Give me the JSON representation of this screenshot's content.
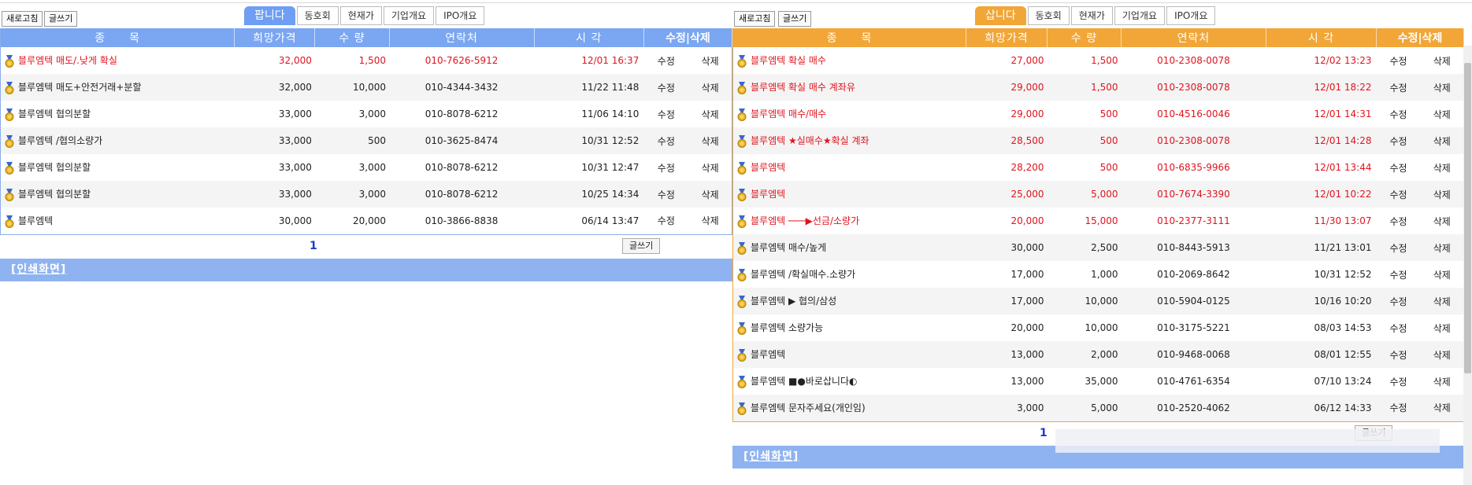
{
  "sell": {
    "refresh_label": "새로고침",
    "write_label": "글쓰기",
    "tabs": [
      "팝니다",
      "동호회",
      "현재가",
      "기업개요",
      "IPO개요"
    ],
    "headers": [
      "종　　목",
      "희망가격",
      "수 량",
      "연락처",
      "시 각",
      "수정|삭제"
    ],
    "rows": [
      {
        "title": "블루엠텍 매도/.낮게 확실",
        "price": "32,000",
        "qty": "1,500",
        "contact": "010-7626-5912",
        "time": "12/01 16:37",
        "red": true
      },
      {
        "title": "블루엠텍 매도+안전거래+분할",
        "price": "32,000",
        "qty": "10,000",
        "contact": "010-4344-3432",
        "time": "11/22 11:48",
        "red": false
      },
      {
        "title": "블루엠텍 협의분할",
        "price": "33,000",
        "qty": "3,000",
        "contact": "010-8078-6212",
        "time": "11/06 14:10",
        "red": false
      },
      {
        "title": "블루엠텍 /협의소량가",
        "price": "33,000",
        "qty": "500",
        "contact": "010-3625-8474",
        "time": "10/31 12:52",
        "red": false
      },
      {
        "title": "블루엠텍 협의분할",
        "price": "33,000",
        "qty": "3,000",
        "contact": "010-8078-6212",
        "time": "10/31 12:47",
        "red": false
      },
      {
        "title": "블루엠텍 협의분할",
        "price": "33,000",
        "qty": "3,000",
        "contact": "010-8078-6212",
        "time": "10/25 14:34",
        "red": false
      },
      {
        "title": "블루엠텍",
        "price": "30,000",
        "qty": "20,000",
        "contact": "010-3866-8838",
        "time": "06/14 13:47",
        "red": false
      }
    ],
    "edit_label": "수정",
    "delete_label": "삭제",
    "page": "1",
    "write_bottom_label": "글쓰기",
    "print_label": "[인쇄화면]"
  },
  "buy": {
    "refresh_label": "새로고침",
    "write_label": "글쓰기",
    "tabs": [
      "삽니다",
      "동호회",
      "현재가",
      "기업개요",
      "IPO개요"
    ],
    "headers": [
      "종　　목",
      "희망가격",
      "수 량",
      "연락처",
      "시 각",
      "수정|삭제"
    ],
    "rows": [
      {
        "title": "블루엠텍 확실 매수",
        "price": "27,000",
        "qty": "1,500",
        "contact": "010-2308-0078",
        "time": "12/02 13:23",
        "red": true
      },
      {
        "title": "블루엠텍 확실 매수 계좌유",
        "price": "29,000",
        "qty": "1,500",
        "contact": "010-2308-0078",
        "time": "12/01 18:22",
        "red": true
      },
      {
        "title": "블루엠텍 매수/매수",
        "price": "29,000",
        "qty": "500",
        "contact": "010-4516-0046",
        "time": "12/01 14:31",
        "red": true
      },
      {
        "title": "블루엠텍 ★실매수★확실 계좌",
        "price": "28,500",
        "qty": "500",
        "contact": "010-2308-0078",
        "time": "12/01 14:28",
        "red": true
      },
      {
        "title": "블루엠텍",
        "price": "28,200",
        "qty": "500",
        "contact": "010-6835-9966",
        "time": "12/01 13:44",
        "red": true
      },
      {
        "title": "블루엠텍",
        "price": "25,000",
        "qty": "5,000",
        "contact": "010-7674-3390",
        "time": "12/01 10:22",
        "red": true
      },
      {
        "title": "블루엠텍 ───▶선금/소량가",
        "price": "20,000",
        "qty": "15,000",
        "contact": "010-2377-3111",
        "time": "11/30 13:07",
        "red": true
      },
      {
        "title": "블루엠텍 매수/높게",
        "price": "30,000",
        "qty": "2,500",
        "contact": "010-8443-5913",
        "time": "11/21 13:01",
        "red": false
      },
      {
        "title": "블루엠텍 /확실매수.소량가",
        "price": "17,000",
        "qty": "1,000",
        "contact": "010-2069-8642",
        "time": "10/31 12:52",
        "red": false
      },
      {
        "title": "블루엠텍 ▶ 협의/삼성",
        "price": "17,000",
        "qty": "10,000",
        "contact": "010-5904-0125",
        "time": "10/16 10:20",
        "red": false
      },
      {
        "title": "블루엠텍 소량가능",
        "price": "20,000",
        "qty": "10,000",
        "contact": "010-3175-5221",
        "time": "08/03 14:53",
        "red": false
      },
      {
        "title": "블루엠텍",
        "price": "13,000",
        "qty": "2,000",
        "contact": "010-9468-0068",
        "time": "08/01 12:55",
        "red": false
      },
      {
        "title": "블루엠텍 ■●바로삽니다◐",
        "price": "13,000",
        "qty": "35,000",
        "contact": "010-4761-6354",
        "time": "07/10 13:24",
        "red": false
      },
      {
        "title": "블루엠텍 문자주세요(개인임)",
        "price": "3,000",
        "qty": "5,000",
        "contact": "010-2520-4062",
        "time": "06/12 14:33",
        "red": false
      }
    ],
    "edit_label": "수정",
    "delete_label": "삭제",
    "page": "1",
    "write_bottom_label": "글쓰기",
    "print_label": "[인쇄화면]"
  },
  "colors": {
    "sell_accent": "#7aa6f2",
    "buy_accent": "#f1a637",
    "highlight_text": "#e0141e",
    "page_link": "#1a3dcc"
  },
  "icons": {
    "row_icon": "medal-icon"
  }
}
